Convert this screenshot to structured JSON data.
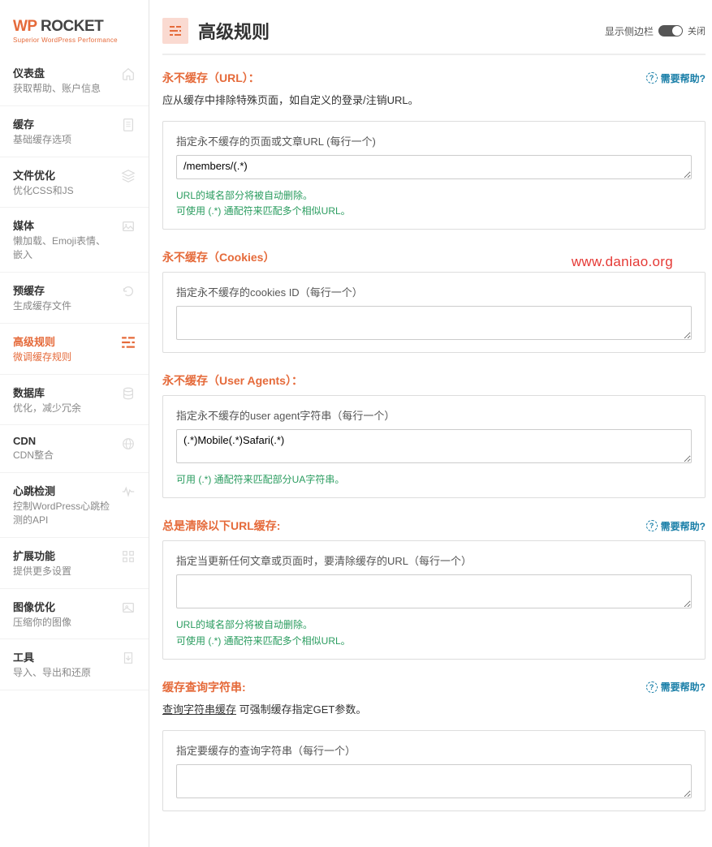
{
  "logo": {
    "part1": "WP",
    "part2": " ROCKET",
    "sub": "Superior WordPress Performance"
  },
  "nav": [
    {
      "title": "仪表盘",
      "sub": "获取帮助、账户信息",
      "name": "nav-dashboard",
      "icon": "home"
    },
    {
      "title": "缓存",
      "sub": "基础缓存选项",
      "name": "nav-cache",
      "icon": "file"
    },
    {
      "title": "文件优化",
      "sub": "优化CSS和JS",
      "name": "nav-file-opt",
      "icon": "layers"
    },
    {
      "title": "媒体",
      "sub": "懒加载、Emoji表情、嵌入",
      "name": "nav-media",
      "icon": "image"
    },
    {
      "title": "预缓存",
      "sub": "生成缓存文件",
      "name": "nav-preload",
      "icon": "refresh"
    },
    {
      "title": "高级规则",
      "sub": "微调缓存规则",
      "name": "nav-advanced",
      "icon": "sliders",
      "active": true
    },
    {
      "title": "数据库",
      "sub": "优化，减少冗余",
      "name": "nav-database",
      "icon": "database"
    },
    {
      "title": "CDN",
      "sub": "CDN整合",
      "name": "nav-cdn",
      "icon": "globe"
    },
    {
      "title": "心跳检测",
      "sub": "控制WordPress心跳检测的API",
      "name": "nav-heartbeat",
      "icon": "heartbeat"
    },
    {
      "title": "扩展功能",
      "sub": "提供更多设置",
      "name": "nav-addons",
      "icon": "grid"
    },
    {
      "title": "图像优化",
      "sub": "压缩你的图像",
      "name": "nav-image-opt",
      "icon": "image2"
    },
    {
      "title": "工具",
      "sub": "导入、导出和还原",
      "name": "nav-tools",
      "icon": "import"
    }
  ],
  "header": {
    "title": "高级规则",
    "sidebar_label": "显示侧边栏",
    "toggle_state": "关闭"
  },
  "help_text": "需要帮助?",
  "sections": {
    "url": {
      "title": "永不缓存（URL）：",
      "desc": "应从缓存中排除特殊页面，如自定义的登录/注销URL。",
      "field_label": "指定永不缓存的页面或文章URL (每行一个)",
      "value": "/members/(.*)",
      "hint1": "URL的域名部分将被自动删除。",
      "hint2": "可使用 (.*) 通配符来匹配多个相似URL。"
    },
    "cookies": {
      "title": "永不缓存（Cookies）",
      "field_label": "指定永不缓存的cookies ID（每行一个）",
      "value": ""
    },
    "ua": {
      "title": "永不缓存（User Agents）：",
      "field_label": "指定永不缓存的user agent字符串（每行一个）",
      "value": "(.*)Mobile(.*)Safari(.*)",
      "hint": "可用 (.*) 通配符来匹配部分UA字符串。"
    },
    "purge": {
      "title": "总是清除以下URL缓存:",
      "field_label": "指定当更新任何文章或页面时，要清除缓存的URL（每行一个）",
      "value": "",
      "hint1": "URL的域名部分将被自动删除。",
      "hint2": "可使用 (.*) 通配符来匹配多个相似URL。"
    },
    "query": {
      "title": "缓存查询字符串:",
      "desc_link": "查询字符串缓存",
      "desc_rest": " 可强制缓存指定GET参数。",
      "field_label": "指定要缓存的查询字符串（每行一个）",
      "value": ""
    }
  },
  "watermark": "www.daniao.org"
}
